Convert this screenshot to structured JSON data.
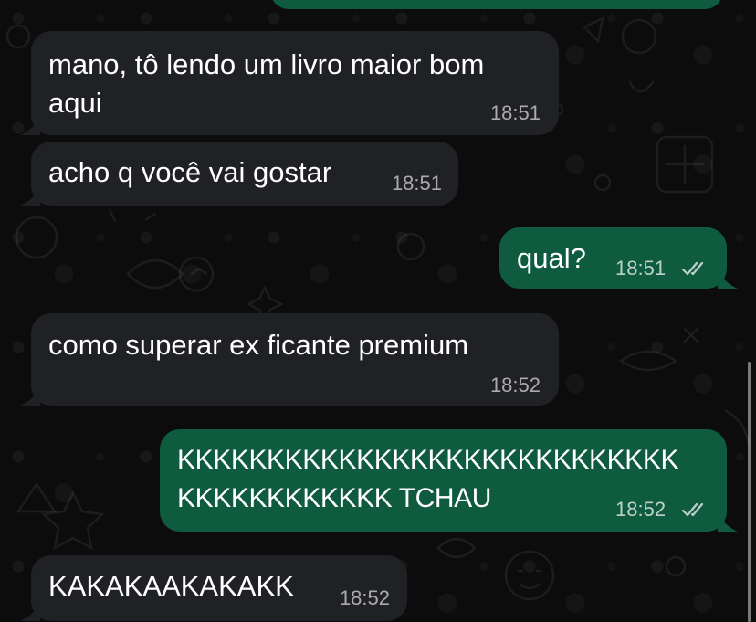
{
  "messages": [
    {
      "id": "m1",
      "direction": "incoming",
      "text": "mano, tô lendo um livro maior bom\naqui",
      "time": "18:51"
    },
    {
      "id": "m2",
      "direction": "incoming",
      "text": "acho q você vai gostar",
      "time": "18:51"
    },
    {
      "id": "m3",
      "direction": "outgoing",
      "text": "qual?",
      "time": "18:51",
      "status": "read"
    },
    {
      "id": "m4",
      "direction": "incoming",
      "text": "como superar ex ficante premium",
      "time": "18:52"
    },
    {
      "id": "m5",
      "direction": "outgoing",
      "text": "KKKKKKKKKKKKKKKKKKKKKKKKKKKK\nKKKKKKKKKKKK TCHAU",
      "time": "18:52",
      "status": "read"
    },
    {
      "id": "m6",
      "direction": "incoming",
      "text": "KAKAKAAKAKAKK",
      "time": "18:52"
    }
  ],
  "icons": {
    "read_receipt": "double-check-icon"
  },
  "colors": {
    "background": "#0c0c0c",
    "incoming_bubble": "#202124",
    "outgoing_bubble": "#0f5b3f",
    "text": "#ffffff",
    "timestamp": "#9d9d9d"
  }
}
